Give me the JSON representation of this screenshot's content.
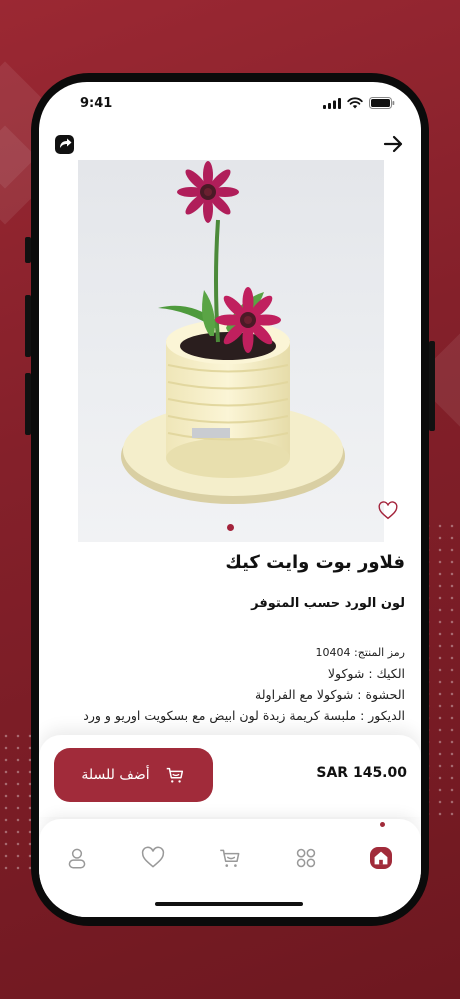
{
  "status_bar": {
    "time": "9:41"
  },
  "product": {
    "title": "فلاور بوت وايت كيك",
    "subtitle": "لون الورد حسب المتوفر",
    "sku": "رمز المنتج: 10404",
    "details": [
      "الكيك : شوكولا",
      "الحشوة : شوكولا مع الفراولة",
      "الديكور : ملبسة كريمة زبدة لون ابيض مع بسكويت اوريو و ورد"
    ],
    "image_page_count": 1,
    "image_page_active": 1
  },
  "purchase": {
    "add_to_cart_label": "أضف للسلة",
    "price": "SAR 145.00"
  },
  "bottom_nav": {
    "items": [
      "profile",
      "favorites",
      "cart",
      "categories",
      "home"
    ],
    "active": "home"
  },
  "colors": {
    "brand": "#a12b3a",
    "background": "#8a2430"
  },
  "icons": [
    "share-icon",
    "arrow-right-icon",
    "heart-icon",
    "cart-icon",
    "user-icon",
    "grid-icon",
    "home-icon"
  ]
}
